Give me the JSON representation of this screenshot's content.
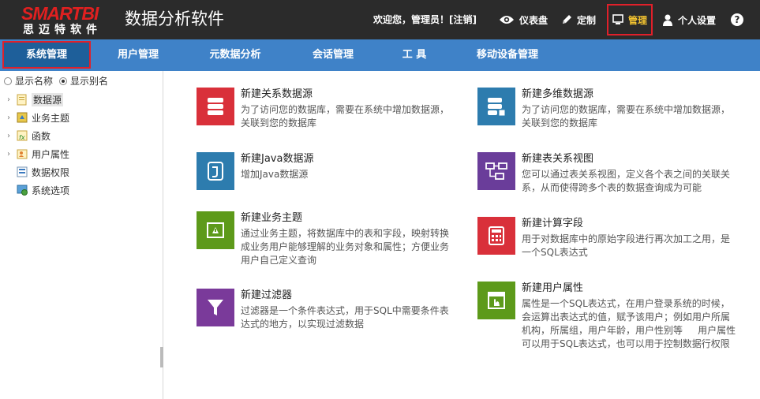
{
  "header": {
    "logo_top": "SMARTBI",
    "logo_bottom": "思迈特软件",
    "app_title": "数据分析软件",
    "welcome": "欢迎您，管理员！[",
    "logout": "注销",
    "welcome_close": "]",
    "dashboard": "仪表盘",
    "customize": "定制",
    "manage": "管理",
    "settings": "个人设置",
    "help": "?",
    "colors": {
      "bg": "#2b2b2b",
      "accent": "#f4c430",
      "highlight": "#e0202a"
    }
  },
  "nav": {
    "tabs": [
      {
        "label": "系统管理",
        "active": true
      },
      {
        "label": "用户管理"
      },
      {
        "label": "元数据分析"
      },
      {
        "label": "会话管理"
      },
      {
        "label": "工 具"
      },
      {
        "label": "移动设备管理"
      }
    ],
    "color": "#3f82c8"
  },
  "sidebar": {
    "radio_show_name": "显示名称",
    "radio_show_alias": "显示别名",
    "items": [
      {
        "label": "数据源",
        "icon": "folder-doc-icon",
        "expandable": true,
        "selected": true
      },
      {
        "label": "业务主题",
        "icon": "business-theme-icon",
        "expandable": true
      },
      {
        "label": "函数",
        "icon": "function-icon",
        "expandable": true
      },
      {
        "label": "用户属性",
        "icon": "user-attr-icon",
        "expandable": true
      },
      {
        "label": "数据权限",
        "icon": "data-permission-icon",
        "expandable": false
      },
      {
        "label": "系统选项",
        "icon": "system-options-icon",
        "expandable": false
      }
    ]
  },
  "cards": [
    {
      "title": "新建关系数据源",
      "desc": "为了访问您的数据库，需要在系统中增加数据源，关联到您的数据库",
      "color": "#d9303a",
      "icon": "database-icon"
    },
    {
      "title": "新建多维数据源",
      "desc": "为了访问您的数据库，需要在系统中增加数据源，关联到您的数据库",
      "color": "#2d7cae",
      "icon": "olap-database-icon"
    },
    {
      "title": "新建Java数据源",
      "desc": "增加Java数据源",
      "color": "#2d7cae",
      "icon": "java-icon"
    },
    {
      "title": "新建表关系视图",
      "desc": "您可以通过表关系视图，定义各个表之间的关联关系，从而使得跨多个表的数据查询成为可能",
      "color": "#6a3d9a",
      "icon": "table-relation-icon"
    },
    {
      "title": "新建业务主题",
      "desc": "通过业务主题，将数据库中的表和字段，映射转换成业务用户能够理解的业务对象和属性；方便业务用户自己定义查询",
      "color": "#5d9a1a",
      "icon": "business-theme-tile-icon"
    },
    {
      "title": "新建计算字段",
      "desc": "用于对数据库中的原始字段进行再次加工之用，是一个SQL表达式",
      "color": "#d9303a",
      "icon": "calculator-icon"
    },
    {
      "title": "新建过滤器",
      "desc": "过滤器是一个条件表达式，用于SQL中需要条件表达式的地方，以实现过滤数据",
      "color": "#7a3a9a",
      "icon": "filter-icon"
    },
    {
      "title": "新建用户属性",
      "desc": "属性是一个SQL表达式，在用户登录系统的时候，会运算出表达式的值，赋予该用户；例如用户所属机构，所属组，用户年龄，用户性别等     用户属性可以用于SQL表达式，也可以用于控制数据行权限",
      "color": "#5d9a1a",
      "icon": "user-attribute-tile-icon"
    }
  ]
}
